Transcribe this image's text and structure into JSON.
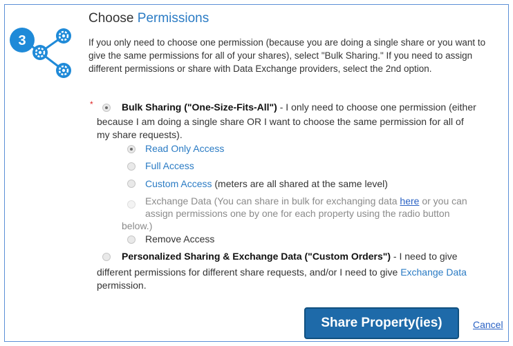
{
  "step": {
    "number": "3"
  },
  "header": {
    "title_prefix": "Choose ",
    "title_accent": "Permissions"
  },
  "intro": "If you only need to choose one permission (because you are doing a single share or you want to give the same permissions for all of your shares), select \"Bulk Sharing.\" If you need to assign different permissions or share with Data Exchange providers, select the 2nd option.",
  "bulk": {
    "required_mark": "*",
    "label": "Bulk Sharing (\"One-Size-Fits-All\")",
    "desc_line1": " - I only need to choose one permission (either",
    "desc_line2": "because I am doing a single share OR I want to choose the same permission for all of",
    "desc_line3": "my share requests).",
    "selected": true
  },
  "permissions": {
    "read_only": {
      "label": "Read Only Access",
      "selected": true
    },
    "full": {
      "label": "Full Access",
      "selected": false
    },
    "custom": {
      "label": "Custom Access",
      "suffix": " (meters are all shared at the same level)",
      "selected": false
    },
    "exchange": {
      "text_before": "Exchange Data (You can share in bulk for exchanging data ",
      "link": "here",
      "text_after": " or you can",
      "line2": "assign permissions one by one for each property using the radio button",
      "line3": "below.)",
      "disabled": true
    },
    "remove": {
      "label": "Remove Access",
      "selected": false
    }
  },
  "personalized": {
    "label": "Personalized Sharing & Exchange Data (\"Custom Orders\")",
    "desc_line1": " - I need to give",
    "desc_line2_before": "different permissions for different share requests, and/or I need to give ",
    "desc_line2_link": "Exchange Data",
    "desc_line3": "permission.",
    "selected": false
  },
  "actions": {
    "share_label": "Share Property(ies)",
    "cancel_label": "Cancel"
  },
  "colors": {
    "accent": "#2a7bc4",
    "step_circle": "#1f8ad8",
    "button": "#1e6aa9",
    "required": "#dd2222"
  }
}
